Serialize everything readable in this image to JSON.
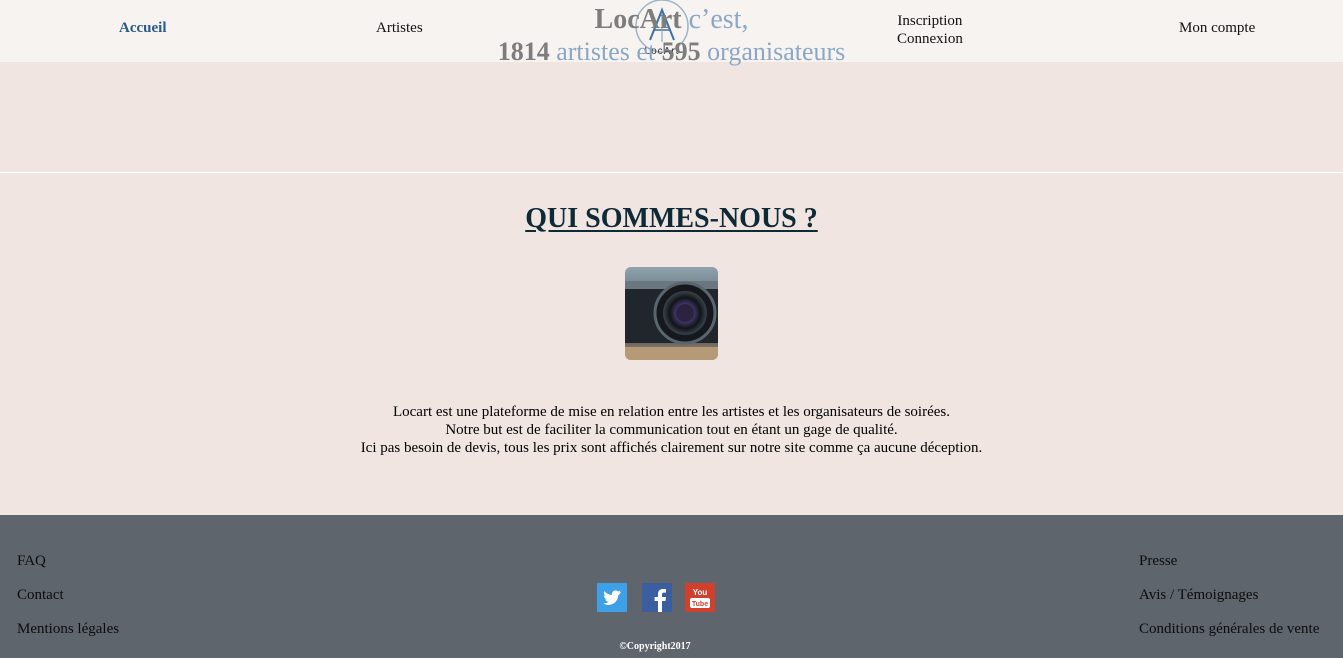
{
  "nav": {
    "home": "Accueil",
    "artists": "Artistes",
    "signup": "Inscription",
    "login": "Connexion",
    "account": "Mon compte"
  },
  "logo": {
    "text": "LocArt"
  },
  "tagline": {
    "brand": "LocArt",
    "cest": "c’est,",
    "artists_count": "1814",
    "artists_label": "artistes",
    "et": "et",
    "organizers_count": "595",
    "organizers_label": "organisateurs"
  },
  "about": {
    "title": "QUI SOMMES-NOUS ?",
    "lines": [
      "Locart est une plateforme de mise en relation entre les artistes et les organisateurs de soirées.",
      "Notre but est de faciliter la communication tout en étant un gage de qualité.",
      "Ici pas besoin de devis, tous les prix sont affichés clairement sur notre site comme ça aucune déception."
    ]
  },
  "footer": {
    "left": [
      "FAQ",
      "Contact",
      "Mentions légales"
    ],
    "right": [
      "Presse",
      "Avis / Témoignages",
      "Conditions générales de vente"
    ],
    "social": [
      "twitter-icon",
      "facebook-icon",
      "youtube-icon"
    ],
    "copyright": "©Copyright2017"
  },
  "colors": {
    "page_bg": "#f0e5e0",
    "nav_bg": "#f7f3f0",
    "footer_bg": "#5f656d",
    "accent": "#2a5a8a",
    "twitter": "#3ea0e6",
    "facebook": "#3b5ea1",
    "youtube": "#d0402c"
  }
}
